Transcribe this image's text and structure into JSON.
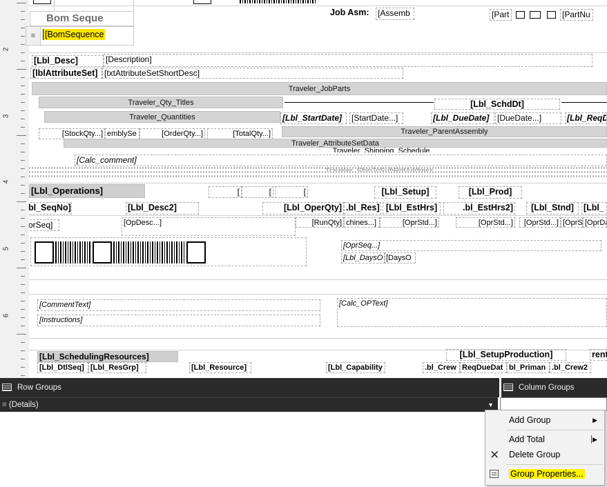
{
  "ruler": {
    "labels": [
      "2",
      "3",
      "4",
      "5",
      "6"
    ]
  },
  "tablix": {
    "header_text": "Bom Seque",
    "handle_glyph": "≡",
    "selected_cell_text": "[BomSequence"
  },
  "fields": {
    "job_asm": "Job Asm:",
    "assemb": "[Assemb",
    "part": "[Part",
    "part_nu": "[PartNu",
    "lbl_desc": "[Lbl_Desc]",
    "description": "[Description]",
    "lbl_attribute_set": "[lblAttributeSet]",
    "txt_attribute_set": "[txtAttributeSetShortDesc]",
    "traveler_job_parts": "Traveler_JobParts",
    "traveler_qty_titles": "Traveler_Qty_Titles",
    "lbl_schd_dt": "[Lbl_SchdDt]",
    "traveler_quantities": "Traveler_Quantities",
    "lbl_start_date": "[Lbl_StartDate]",
    "start_date": "[StartDate...]",
    "lbl_due_date": "[Lbl_DueDate]",
    "due_date": "[DueDate...]",
    "lbl_req": "[Lbl_ReqD",
    "stock_qty": "[StockQty...]",
    "embly_se": "emblySe",
    "order_qty": "[OrderQty...]",
    "total_qty": "[TotalQty...]",
    "traveler_parent_assembly": "Traveler_ParentAssembly",
    "traveler_attribute_set_data": "Traveler_AttributeSetData",
    "traveler_shipping_schedule": "Traveler_Shipping_Schedule",
    "calc_comment": "[Calc_comment]",
    "traveler_hidden": "Traveler_ShipToSubRptAddress",
    "lbl_operations": "[Lbl_Operations]",
    "br1": "[",
    "br2": "[",
    "br3": "[",
    "lbl_setup": "[Lbl_Setup]",
    "lbl_prod": "[Lbl_Prod]",
    "lbl_seq_no": "bl_SeqNo]",
    "lbl_desc2": "[Lbl_Desc2]",
    "lbl_oper_qty": "[Lbl_OperQty]",
    "lbl_res": ".bl_Res]",
    "lbl_est_hrs": "[Lbl_EstHrs]",
    "lbl_est_hrs2": ".bl_EstHrs2]",
    "lbl_stnd": "[Lbl_Stnd]",
    "lbl_last": "[Lbl_",
    "opr_seq": "orSeq]",
    "op_desc": "[OpDesc...]",
    "run_qty": "[RunQty]",
    "machines": "chines...]",
    "opr_std1": "[OprStd...]",
    "opr_std2": "[OprStd...]",
    "opr_std3": "[OprStd...]",
    "opr_s": "[OprS",
    "opr_d": "[OprDa",
    "opr_seq2": "[OprSeq...]",
    "lbl_days_o": "[Lbl_DaysO",
    "days_o": "[DaysO",
    "comment_text": "[CommentText]",
    "calc_op_text": "[Calc_OPText]",
    "instructions": "[Instructions]",
    "lbl_scheduling_resources": "[Lbl_SchedulingResources]",
    "lbl_setup_production": "[Lbl_SetupProduction]",
    "rent": "rent",
    "lbl_dtl_seq": "[Lbl_DtlSeq]",
    "lbl_res_grp": "[Lbl_ResGrp]",
    "lbl_resource": "[Lbl_Resource]",
    "lbl_capability": "[Lbl_Capability",
    "lbl_crew": ".bl_Crew",
    "req_due_dat": "ReqDueDat",
    "lbl_priman": "bl_Priman",
    "lbl_crew2": ".bl_Crew2"
  },
  "panes": {
    "row_groups": "Row Groups",
    "column_groups": "Column Groups",
    "details_glyph": "≡",
    "details": "(Details)"
  },
  "context_menu": {
    "add_group": "Add Group",
    "add_total": "Add Total",
    "delete_group": "Delete Group",
    "group_properties": "Group Properties..."
  },
  "colors": {
    "highlight": "#fff200",
    "pane_header": "#2b2b2b",
    "menu_bg": "#f2f2f2"
  }
}
